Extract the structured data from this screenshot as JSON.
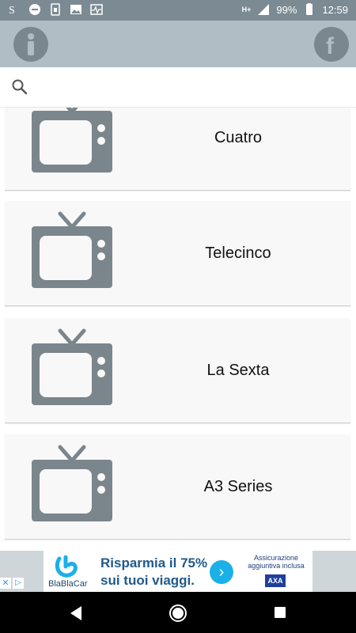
{
  "status_bar": {
    "network": "H+",
    "battery": "99%",
    "time": "12:59"
  },
  "app_bar": {
    "info_icon": "info-icon",
    "facebook_icon": "facebook-icon",
    "color": "#b1bdc4"
  },
  "search": {
    "placeholder": "",
    "value": ""
  },
  "channels": [
    {
      "name": "Cuatro"
    },
    {
      "name": "Telecinco"
    },
    {
      "name": "La Sexta"
    },
    {
      "name": "A3 Series"
    }
  ],
  "ad": {
    "brand": "BlaBlaCar",
    "headline_line1": "Risparmia il 75%",
    "headline_line2": "sui tuoi viaggi.",
    "side_line1": "Assicurazione",
    "side_line2": "aggiuntiva inclusa",
    "side_brand": "AXA"
  }
}
